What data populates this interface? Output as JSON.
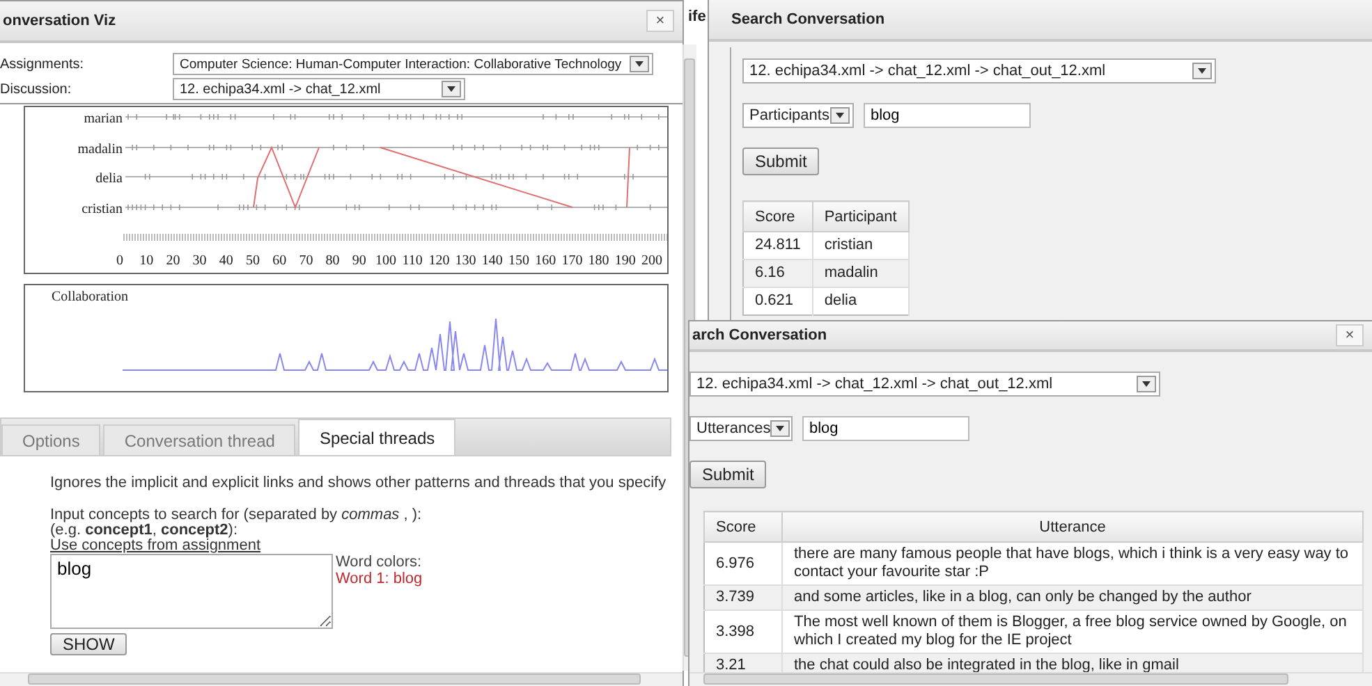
{
  "viz_window": {
    "title": "onversation Viz",
    "close": "×",
    "fields": [
      {
        "label": "Assignments:",
        "value": "Computer Science: Human-Computer Interaction: Collaborative Technology"
      },
      {
        "label": "Discussion:",
        "value": "12. echipa34.xml -> chat_12.xml"
      }
    ],
    "timeline": {
      "participants": [
        "marian",
        "madalin",
        "delia",
        "cristian"
      ],
      "axis_labels": [
        "0",
        "10",
        "20",
        "30",
        "40",
        "50",
        "60",
        "70",
        "80",
        "90",
        "100",
        "110",
        "120",
        "130",
        "140",
        "150",
        "160",
        "170",
        "180",
        "190",
        "200"
      ]
    },
    "collaboration": {
      "title": "Collaboration"
    },
    "tabs": [
      {
        "label": "Options",
        "selected": false
      },
      {
        "label": "Conversation thread",
        "selected": false
      },
      {
        "label": "Special threads",
        "selected": true
      }
    ],
    "special_threads": {
      "description": "Ignores the implicit and explicit links and shows other patterns and threads that you specify",
      "prompt": "Input concepts to search for (separated by *commas* , ):",
      "example": "(e.g. **concept1**, **concept2**):",
      "link": "Use concepts from assignment",
      "concepts_value": "blog",
      "word_colors_label": "Word colors:",
      "word_colors": [
        {
          "text": "Word 1: blog",
          "color": "#c0282d"
        }
      ],
      "show_button": "SHOW"
    }
  },
  "background_window": {
    "title": "ife"
  },
  "search_windows": [
    {
      "title": "Search Conversation",
      "discussion": "12. echipa34.xml -> chat_12.xml -> chat_out_12.xml",
      "mode": "Participants",
      "query": "blog",
      "submit": "Submit",
      "columns": [
        "Score",
        "Participant"
      ],
      "rows": [
        [
          "24.811",
          "cristian"
        ],
        [
          "6.16",
          "madalin"
        ],
        [
          "0.621",
          "delia"
        ]
      ]
    },
    {
      "title": "arch Conversation",
      "close": "×",
      "discussion": "12. echipa34.xml -> chat_12.xml -> chat_out_12.xml",
      "mode": "Utterances",
      "query": "blog",
      "submit": "Submit",
      "columns": [
        "Score",
        "Utterance"
      ],
      "rows": [
        [
          "6.976",
          "there are many famous people that have blogs, which i think is a very easy way to contact your favourite star :P"
        ],
        [
          "3.739",
          "and some articles, like in a blog, can only be changed by the author"
        ],
        [
          "3.398",
          "The most well known of them is Blogger, a free blog service owned by Google, on which I created my blog for the IE project"
        ],
        [
          "3.21",
          "the chat could also be integrated in the blog, like in gmail"
        ]
      ]
    }
  ]
}
